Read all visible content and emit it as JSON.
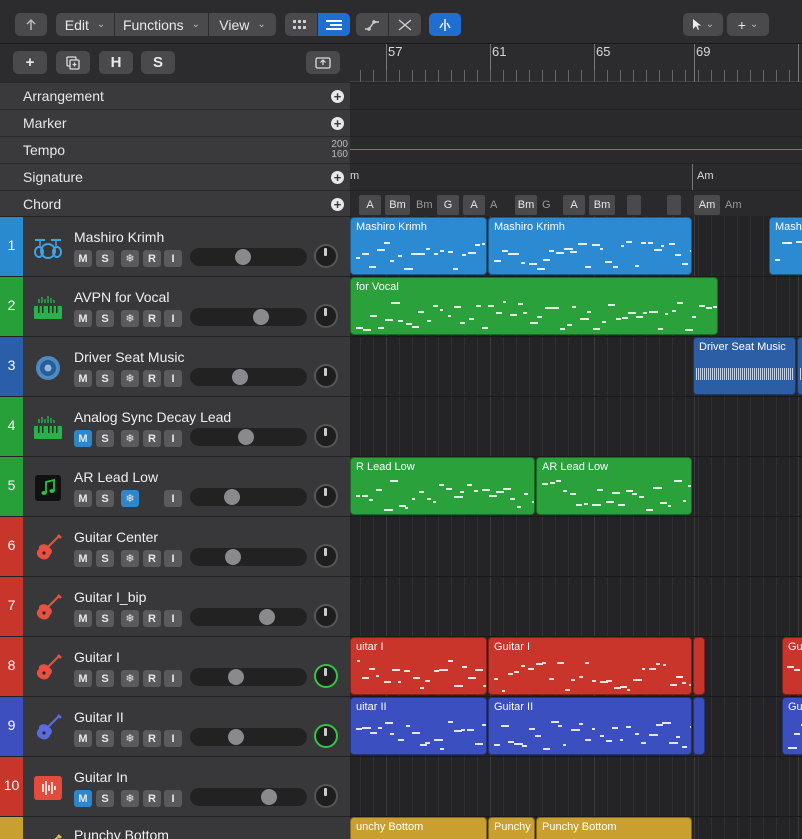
{
  "toolbar": {
    "back_icon": "back-arrow-icon",
    "edit": "Edit",
    "functions": "Functions",
    "view": "View"
  },
  "header": {
    "add_label": "+",
    "h_label": "H",
    "s_label": "S"
  },
  "global_tracks": [
    {
      "label": "Arrangement"
    },
    {
      "label": "Marker"
    },
    {
      "label": "Tempo",
      "max": "200",
      "min": "160"
    },
    {
      "label": "Signature"
    },
    {
      "label": "Chord"
    }
  ],
  "ruler": {
    "bars": [
      "57",
      "61",
      "65",
      "69"
    ]
  },
  "signature_lane": {
    "left_text": "m",
    "right_text": "Am"
  },
  "chords": [
    {
      "label": "A",
      "box": true
    },
    {
      "label": "Bm",
      "box": true
    },
    {
      "label": "Bm",
      "box": false
    },
    {
      "label": "G",
      "box": true
    },
    {
      "label": "A",
      "box": true
    },
    {
      "label": "A",
      "box": false
    },
    {
      "label": "Bm",
      "box": true
    },
    {
      "label": "G",
      "box": false
    },
    {
      "label": "A",
      "box": true
    },
    {
      "label": "Bm",
      "box": true
    },
    {
      "label": "",
      "box": true
    },
    {
      "label": "",
      "box": true
    },
    {
      "label": "Am",
      "box": true
    },
    {
      "label": "Am",
      "box": false
    }
  ],
  "tracks": [
    {
      "num": "1",
      "name": "Mashiro Krimh",
      "color": "#2a8ad0",
      "icon": "drum-kit-icon",
      "m": "M",
      "s": "S",
      "r": "R",
      "i": "I",
      "m_on": false,
      "fz_on": false,
      "show_r": true,
      "volume": 0.45,
      "pan_green": false
    },
    {
      "num": "2",
      "name": "AVPN for Vocal",
      "color": "#28a03a",
      "icon": "synth-keyboard-icon",
      "m": "M",
      "s": "S",
      "r": "R",
      "i": "I",
      "m_on": false,
      "fz_on": false,
      "show_r": true,
      "volume": 0.64,
      "pan_green": false
    },
    {
      "num": "3",
      "name": "Driver Seat Music",
      "color": "#2a5ea8",
      "icon": "speaker-icon",
      "m": "M",
      "s": "S",
      "r": "R",
      "i": "I",
      "m_on": false,
      "fz_on": false,
      "show_r": true,
      "volume": 0.42,
      "pan_green": false
    },
    {
      "num": "4",
      "name": "Analog Sync Decay Lead",
      "color": "#28a03a",
      "icon": "synth-keyboard-icon",
      "m": "M",
      "s": "S",
      "r": "R",
      "i": "I",
      "m_on": true,
      "fz_on": false,
      "show_r": true,
      "volume": 0.48,
      "pan_green": false
    },
    {
      "num": "5",
      "name": "AR Lead Low",
      "color": "#28a03a",
      "icon": "music-note-icon",
      "m": "M",
      "s": "S",
      "r": "",
      "i": "I",
      "m_on": false,
      "fz_on": true,
      "show_r": false,
      "volume": 0.34,
      "pan_green": false
    },
    {
      "num": "6",
      "name": "Guitar Center",
      "color": "#c8352a",
      "icon": "electric-guitar-icon",
      "m": "M",
      "s": "S",
      "r": "R",
      "i": "I",
      "m_on": false,
      "fz_on": false,
      "show_r": true,
      "volume": 0.35,
      "pan_green": false
    },
    {
      "num": "7",
      "name": "Guitar I_bip",
      "color": "#c8352a",
      "icon": "electric-guitar-icon",
      "m": "M",
      "s": "S",
      "r": "R",
      "i": "I",
      "m_on": false,
      "fz_on": false,
      "show_r": true,
      "volume": 0.7,
      "pan_green": false
    },
    {
      "num": "8",
      "name": "Guitar I",
      "color": "#c8352a",
      "icon": "electric-guitar-icon",
      "m": "M",
      "s": "S",
      "r": "R",
      "i": "I",
      "m_on": false,
      "fz_on": false,
      "show_r": true,
      "volume": 0.38,
      "pan_green": true
    },
    {
      "num": "9",
      "name": "Guitar II",
      "color": "#3d4fbf",
      "icon": "electric-guitar-icon",
      "m": "M",
      "s": "S",
      "r": "R",
      "i": "I",
      "m_on": false,
      "fz_on": false,
      "show_r": true,
      "volume": 0.38,
      "pan_green": true
    },
    {
      "num": "10",
      "name": "Guitar In",
      "color": "#c8352a",
      "icon": "audio-waveform-icon",
      "m": "M",
      "s": "S",
      "r": "R",
      "i": "I",
      "m_on": true,
      "fz_on": false,
      "show_r": true,
      "volume": 0.72,
      "pan_green": false
    },
    {
      "num": "",
      "name": "Punchy Bottom",
      "color": "#c8a030",
      "icon": "electric-guitar-icon",
      "m": "",
      "s": "",
      "r": "",
      "i": "",
      "m_on": false,
      "fz_on": false,
      "show_r": false,
      "volume": 0.5,
      "pan_green": false
    }
  ],
  "regions": [
    {
      "track": 0,
      "name": "Mashiro Krimh",
      "start": 0,
      "end": 137,
      "color": "#2b8ad2",
      "kind": "midi"
    },
    {
      "track": 0,
      "name": "Mashiro Krimh",
      "start": 138,
      "end": 342,
      "color": "#2b8ad2",
      "kind": "midi"
    },
    {
      "track": 0,
      "name": "Mashiro Krimh",
      "start": 419,
      "end": 470,
      "color": "#2b8ad2",
      "kind": "midi"
    },
    {
      "track": 1,
      "name": "for Vocal",
      "start": 0,
      "end": 368,
      "color": "#2aa13b",
      "kind": "midi"
    },
    {
      "track": 2,
      "name": "Driver Seat Music",
      "start": 343,
      "end": 446,
      "color": "#2c5ea6",
      "kind": "audio"
    },
    {
      "track": 2,
      "name": "C",
      "start": 447,
      "end": 470,
      "color": "#2c5ea6",
      "kind": "audio"
    },
    {
      "track": 4,
      "name": "R Lead Low",
      "start": 0,
      "end": 185,
      "color": "#2aa13b",
      "kind": "midi"
    },
    {
      "track": 4,
      "name": "AR Lead Low",
      "start": 186,
      "end": 342,
      "color": "#2aa13b",
      "kind": "midi"
    },
    {
      "track": 7,
      "name": "uitar I",
      "start": 0,
      "end": 137,
      "color": "#c9352a",
      "kind": "midi"
    },
    {
      "track": 7,
      "name": "Guitar I",
      "start": 138,
      "end": 342,
      "color": "#c9352a",
      "kind": "midi"
    },
    {
      "track": 7,
      "name": "",
      "start": 343,
      "end": 355,
      "color": "#c9352a",
      "kind": "midi"
    },
    {
      "track": 7,
      "name": "Gu",
      "start": 432,
      "end": 470,
      "color": "#c9352a",
      "kind": "midi"
    },
    {
      "track": 8,
      "name": "uitar II",
      "start": 0,
      "end": 137,
      "color": "#3b4fc0",
      "kind": "midi"
    },
    {
      "track": 8,
      "name": "Guitar II",
      "start": 138,
      "end": 342,
      "color": "#3b4fc0",
      "kind": "midi"
    },
    {
      "track": 8,
      "name": "",
      "start": 343,
      "end": 355,
      "color": "#3b4fc0",
      "kind": "midi"
    },
    {
      "track": 8,
      "name": "Gu",
      "start": 432,
      "end": 470,
      "color": "#3b4fc0",
      "kind": "midi"
    },
    {
      "track": 10,
      "name": "unchy Bottom",
      "start": 0,
      "end": 137,
      "color": "#c9a02f",
      "kind": "midi"
    },
    {
      "track": 10,
      "name": "Punchy",
      "start": 138,
      "end": 185,
      "color": "#c9a02f",
      "kind": "midi"
    },
    {
      "track": 10,
      "name": "Punchy Bottom",
      "start": 186,
      "end": 342,
      "color": "#c9a02f",
      "kind": "midi"
    }
  ]
}
